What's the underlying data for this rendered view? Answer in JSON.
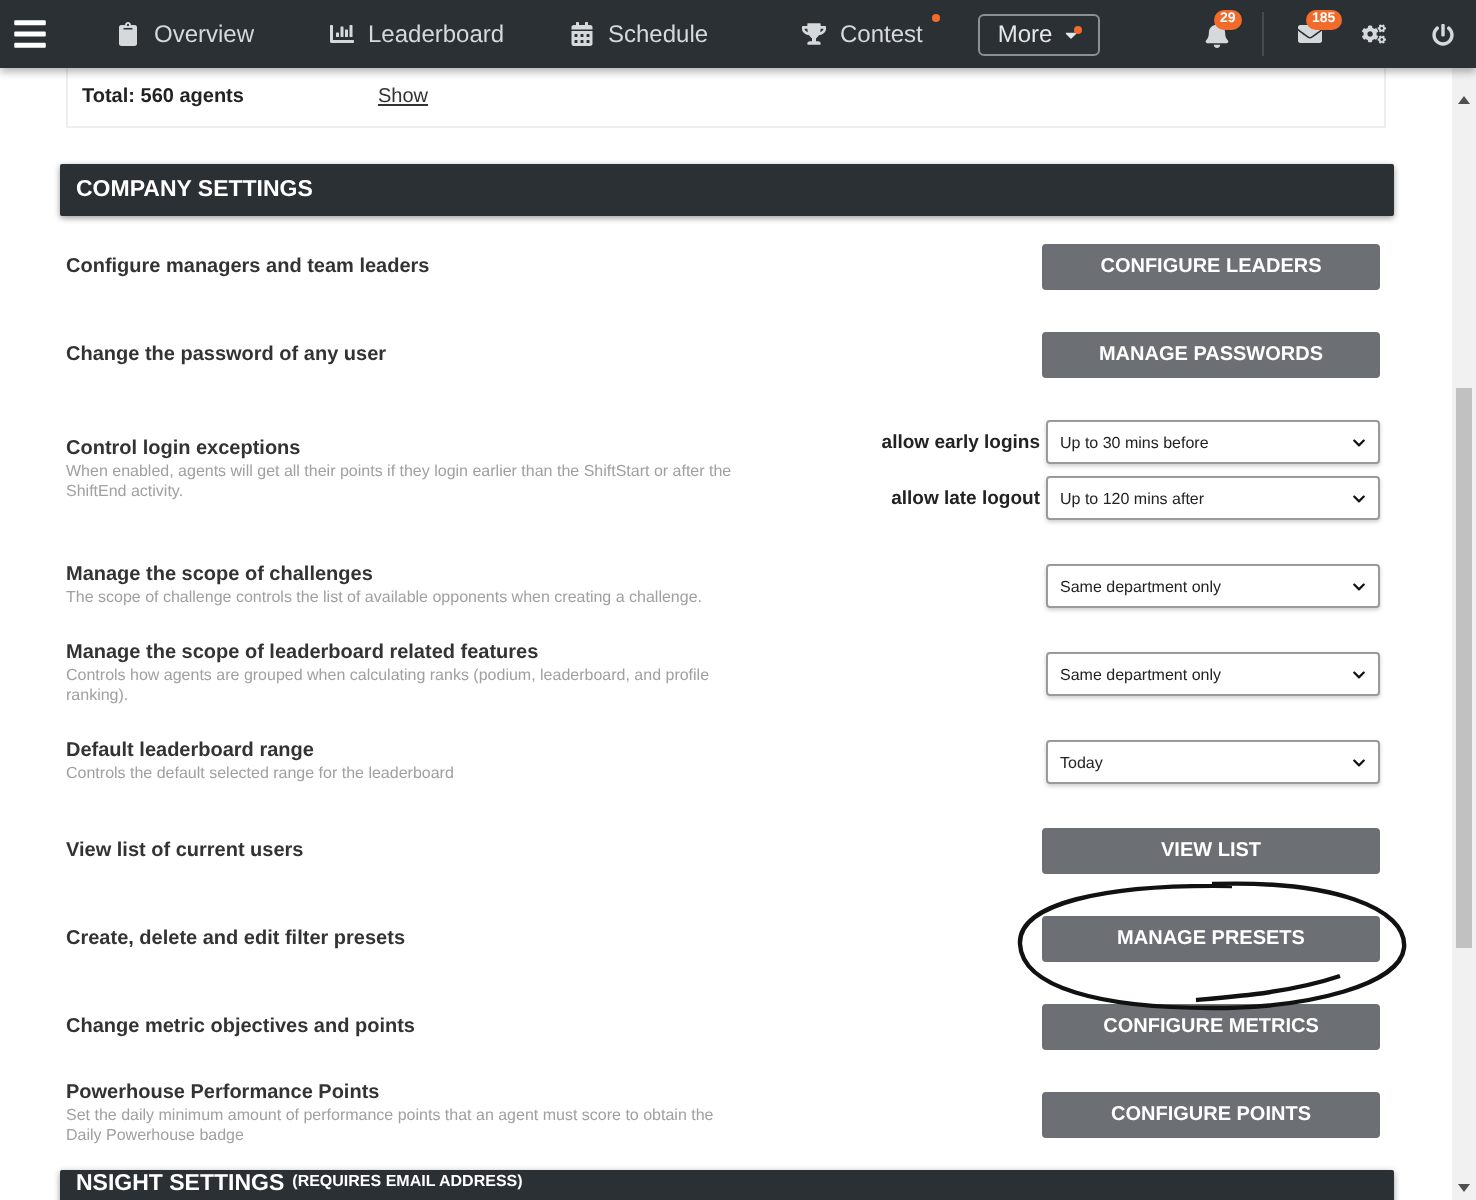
{
  "nav": {
    "items": [
      {
        "label": "Overview",
        "dot": false
      },
      {
        "label": "Leaderboard",
        "dot": false
      },
      {
        "label": "Schedule",
        "dot": false
      },
      {
        "label": "Contest",
        "dot": true
      }
    ],
    "more": {
      "label": "More",
      "dot": true
    },
    "notifications": "29",
    "messages": "185"
  },
  "summary": {
    "total": "Total: 560 agents",
    "link": "Show"
  },
  "section": {
    "title": "COMPANY SETTINGS",
    "rows": [
      {
        "kind": "button",
        "label": "Configure managers and team leaders",
        "button": "CONFIGURE LEADERS"
      },
      {
        "kind": "button",
        "label": "Change the password of any user",
        "button": "MANAGE PASSWORDS"
      },
      {
        "kind": "selects",
        "label": "Control login exceptions",
        "description": "When enabled, agents will get all their points if they login earlier than the ShiftStart or after the ShiftEnd activity.",
        "selects": [
          {
            "label": "allow early logins",
            "value": "Up to 30 mins before"
          },
          {
            "label": "allow late logout",
            "value": "Up to 120 mins after"
          }
        ]
      },
      {
        "kind": "select",
        "label": "Manage the scope of challenges",
        "description": "The scope of challenge controls the list of available opponents when creating a challenge.",
        "value": "Same department only"
      },
      {
        "kind": "select",
        "label": "Manage the scope of leaderboard related features",
        "description": "Controls how agents are grouped when calculating ranks (podium, leaderboard, and profile ranking).",
        "value": "Same department only"
      },
      {
        "kind": "select",
        "label": "Default leaderboard range",
        "description": "Controls the default selected range for the leaderboard",
        "value": "Today"
      },
      {
        "kind": "button",
        "label": "View list of current users",
        "button": "VIEW LIST"
      },
      {
        "kind": "button",
        "label": "Create, delete and edit filter presets",
        "button": "MANAGE PRESETS",
        "circled": true
      },
      {
        "kind": "button",
        "label": "Change metric objectives and points",
        "button": "CONFIGURE METRICS"
      },
      {
        "kind": "button",
        "label": "Powerhouse Performance Points",
        "description": "Set the daily minimum amount of performance points that an agent must score to obtain the Daily Powerhouse badge",
        "button": "CONFIGURE POINTS"
      }
    ]
  },
  "next_section": {
    "title": "NSIGHT SETTINGS",
    "note": "(REQUIRES EMAIL ADDRESS)"
  }
}
